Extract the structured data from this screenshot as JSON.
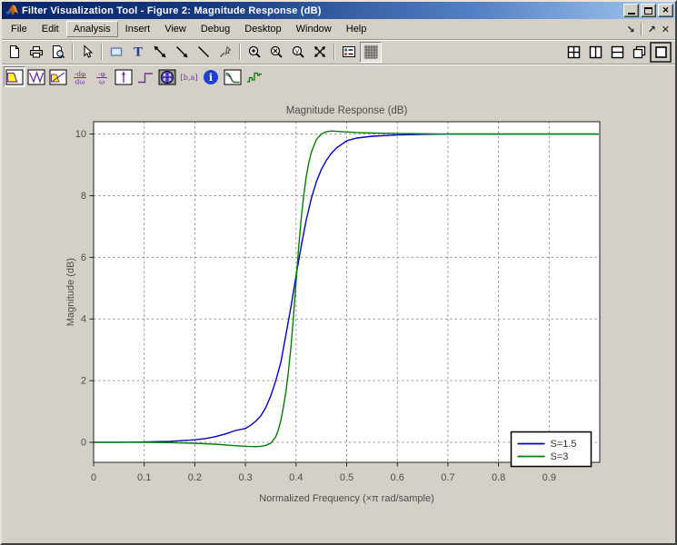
{
  "window": {
    "title": "Filter Visualization Tool - Figure 2: Magnitude Response (dB)",
    "controls": [
      "minimize",
      "maximize",
      "close"
    ]
  },
  "icons": {
    "close_glyph": "✕",
    "dock_figure": "↘",
    "undock_figure": "↗",
    "close_figure": "✕",
    "zoom_y_glyph": "y"
  },
  "menubar": {
    "items": [
      "File",
      "Edit",
      "Analysis",
      "Insert",
      "View",
      "Debug",
      "Desktop",
      "Window",
      "Help"
    ],
    "active_item": "Analysis"
  },
  "toolbar_main": {
    "buttons": [
      "new-document",
      "print",
      "print-preview",
      "edit-plot",
      "insert-rectangle",
      "insert-text",
      "insert-double-arrow",
      "insert-arrow",
      "insert-line",
      "pin-to-axes",
      "zoom-in",
      "zoom-x",
      "zoom-y",
      "full-view",
      "toggle-legend",
      "toggle-grid"
    ],
    "window_buttons": [
      "view-quad",
      "view-split-vertical",
      "view-split-horizontal",
      "view-cascade",
      "view-single"
    ],
    "pressed": [
      "toggle-grid",
      "view-single"
    ],
    "insert_text_glyph": "T"
  },
  "toolbar_analysis": {
    "buttons": [
      "magnitude-response",
      "phase-response",
      "magnitude-and-phase",
      "group-delay",
      "phase-delay",
      "impulse-response",
      "step-response",
      "pole-zero",
      "filter-coefficients",
      "filter-information",
      "magnitude-response-estimate",
      "round-off-noise-power-spectrum"
    ],
    "selected": "magnitude-response",
    "glyphs": {
      "group_delay_num": "-dφ",
      "group_delay_den": "dω",
      "phase_delay_num": "-φ",
      "phase_delay_den": "ω",
      "coefficients": "[b,a]",
      "info": "i"
    }
  },
  "chart_data": {
    "type": "line",
    "title": "Magnitude Response (dB)",
    "xlabel": "Normalized Frequency (×π rad/sample)",
    "ylabel": "Magnitude (dB)",
    "xlim": [
      0,
      1
    ],
    "ylim": [
      -0.65,
      10.4
    ],
    "xticks": [
      0,
      0.1,
      0.2,
      0.3,
      0.4,
      0.5,
      0.6,
      0.7,
      0.8,
      0.9
    ],
    "xtick_labels": [
      "0",
      "0.1",
      "0.2",
      "0.3",
      "0.4",
      "0.5",
      "0.6",
      "0.7",
      "0.8",
      "0.9"
    ],
    "yticks": [
      0,
      2,
      4,
      6,
      8,
      10
    ],
    "ytick_labels": [
      "0",
      "2",
      "4",
      "6",
      "8",
      "10"
    ],
    "grid": true,
    "legend": {
      "position": "southeast",
      "entries": [
        "S=1.5",
        "S=3"
      ]
    },
    "series": [
      {
        "name": "S=1.5",
        "color": "#0000C8",
        "points": [
          [
            0,
            0
          ],
          [
            0.05,
            0
          ],
          [
            0.1,
            0.01
          ],
          [
            0.15,
            0.03
          ],
          [
            0.2,
            0.08
          ],
          [
            0.22,
            0.12
          ],
          [
            0.24,
            0.18
          ],
          [
            0.26,
            0.27
          ],
          [
            0.28,
            0.38
          ],
          [
            0.3,
            0.45
          ],
          [
            0.31,
            0.55
          ],
          [
            0.32,
            0.68
          ],
          [
            0.33,
            0.85
          ],
          [
            0.34,
            1.12
          ],
          [
            0.35,
            1.5
          ],
          [
            0.36,
            2.0
          ],
          [
            0.37,
            2.6
          ],
          [
            0.38,
            3.5
          ],
          [
            0.39,
            4.4
          ],
          [
            0.4,
            5.4
          ],
          [
            0.41,
            6.35
          ],
          [
            0.42,
            7.2
          ],
          [
            0.43,
            7.9
          ],
          [
            0.44,
            8.45
          ],
          [
            0.45,
            8.85
          ],
          [
            0.46,
            9.15
          ],
          [
            0.47,
            9.38
          ],
          [
            0.48,
            9.55
          ],
          [
            0.5,
            9.78
          ],
          [
            0.52,
            9.87
          ],
          [
            0.55,
            9.93
          ],
          [
            0.6,
            9.97
          ],
          [
            0.65,
            9.99
          ],
          [
            0.7,
            10
          ],
          [
            0.8,
            10
          ],
          [
            0.9,
            10
          ],
          [
            0.998,
            10
          ]
        ]
      },
      {
        "name": "S=3",
        "color": "#007F00",
        "points": [
          [
            0,
            0
          ],
          [
            0.1,
            0
          ],
          [
            0.15,
            -0.01
          ],
          [
            0.2,
            -0.03
          ],
          [
            0.24,
            -0.06
          ],
          [
            0.27,
            -0.1
          ],
          [
            0.3,
            -0.13
          ],
          [
            0.32,
            -0.14
          ],
          [
            0.33,
            -0.13
          ],
          [
            0.34,
            -0.1
          ],
          [
            0.35,
            -0.03
          ],
          [
            0.36,
            0.18
          ],
          [
            0.365,
            0.4
          ],
          [
            0.37,
            0.72
          ],
          [
            0.375,
            1.15
          ],
          [
            0.38,
            1.65
          ],
          [
            0.385,
            2.3
          ],
          [
            0.39,
            3.1
          ],
          [
            0.395,
            4.1
          ],
          [
            0.4,
            5.2
          ],
          [
            0.405,
            6.3
          ],
          [
            0.41,
            7.25
          ],
          [
            0.415,
            8.0
          ],
          [
            0.42,
            8.6
          ],
          [
            0.425,
            9.05
          ],
          [
            0.43,
            9.4
          ],
          [
            0.44,
            9.82
          ],
          [
            0.45,
            10.0
          ],
          [
            0.46,
            10.08
          ],
          [
            0.47,
            10.1
          ],
          [
            0.49,
            10.08
          ],
          [
            0.52,
            10.05
          ],
          [
            0.56,
            10.03
          ],
          [
            0.6,
            10.02
          ],
          [
            0.7,
            10.0
          ],
          [
            0.8,
            10
          ],
          [
            0.9,
            10
          ],
          [
            0.998,
            10
          ]
        ]
      }
    ]
  },
  "colors": {
    "titlebar_left": "#0a246a",
    "titlebar_right": "#a6caf0",
    "chrome": "#d4d0c8",
    "plot_bg": "#ffffff",
    "grid": "#8a8a8a",
    "series1": "#0000C8",
    "series2": "#007F00"
  }
}
